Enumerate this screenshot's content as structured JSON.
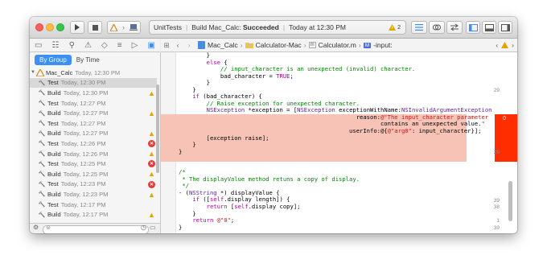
{
  "toolbar": {
    "run_icon": "play-icon",
    "stop_icon": "stop-icon",
    "scheme_icon": "scheme-icon",
    "scheme_device_icon": "computer-icon",
    "activity": {
      "project": "UnitTests",
      "status_prefix": "Build Mac_Calc: ",
      "status_result": "Succeeded",
      "time": "Today at 12:30 PM",
      "warning_count": "2"
    }
  },
  "navigator_tabs": [
    "folder-icon",
    "hierarchy-icon",
    "search-icon",
    "warning-icon",
    "test-diamond-icon",
    "debug-icon",
    "breakpoint-icon",
    "report-icon"
  ],
  "navigator": {
    "group_by": "By Group",
    "by_time": "By Time",
    "root": {
      "name": "Mac_Calc",
      "time": "Today, 12:30 PM"
    },
    "items": [
      {
        "type": "Test",
        "time": "Today, 12:30 PM",
        "status": "",
        "selected": true
      },
      {
        "type": "Build",
        "time": "Today, 12:30 PM",
        "status": "warning"
      },
      {
        "type": "Test",
        "time": "Today, 12:27 PM",
        "status": ""
      },
      {
        "type": "Build",
        "time": "Today, 12:27 PM",
        "status": "warning"
      },
      {
        "type": "Test",
        "time": "Today, 12:27 PM",
        "status": ""
      },
      {
        "type": "Build",
        "time": "Today, 12:27 PM",
        "status": "warning"
      },
      {
        "type": "Test",
        "time": "Today, 12:26 PM",
        "status": "error"
      },
      {
        "type": "Build",
        "time": "Today, 12:26 PM",
        "status": "warning"
      },
      {
        "type": "Test",
        "time": "Today, 12:25 PM",
        "status": "error"
      },
      {
        "type": "Build",
        "time": "Today, 12:25 PM",
        "status": "warning"
      },
      {
        "type": "Test",
        "time": "Today, 12:23 PM",
        "status": "error"
      },
      {
        "type": "Build",
        "time": "Today, 12:23 PM",
        "status": "warning"
      },
      {
        "type": "Test",
        "time": "Today, 12:17 PM",
        "status": ""
      },
      {
        "type": "Build",
        "time": "Today, 12:17 PM",
        "status": "warning"
      }
    ]
  },
  "jumpbar": {
    "project": "Mac_Calc",
    "group": "Calculator-Mac",
    "file_prefix": "m",
    "file": "Calculator.m",
    "method_prefix": "M",
    "method": "-input:"
  },
  "editor": {
    "lines": [
      "        }",
      "        else {",
      "            // input_character is an unexpected (invalid) character.",
      "            bad_character = TRUE;",
      "        }",
      "    }",
      "    if (bad_character) {",
      "        // Raise exception for unexpected character.",
      "        NSException *exception = [NSException exceptionWithName:NSInvalidArgumentException",
      "                                                   reason:@\"The input_character parameter",
      "                                                          contains an unexpected value.\"",
      "                                                 userInfo:@{@\"arg0\": input_character}];",
      "        [exception raise];",
      "    }",
      "}",
      "",
      "",
      "/*",
      " * The displayValue method retuns a copy of display.",
      " */",
      "- (NSString *) displayValue {",
      "    if ([self.display length]) {",
      "        return [self.display copy];",
      "    }",
      "    return @\"0\";",
      "}",
      "",
      "",
      "@end"
    ],
    "annotations": [
      {
        "line": 5,
        "text": "29"
      },
      {
        "line": 8,
        "text": "0"
      },
      {
        "line": 14,
        "text": "29"
      },
      {
        "line": 21,
        "text": "39"
      },
      {
        "line": 22,
        "text": "38"
      },
      {
        "line": 24,
        "text": "1"
      },
      {
        "line": 25,
        "text": "39"
      }
    ]
  },
  "colors": {
    "accent": "#3d8ff5",
    "error": "#ff2d00",
    "error_bg": "#f6c3b6",
    "warning": "#e3a400"
  }
}
